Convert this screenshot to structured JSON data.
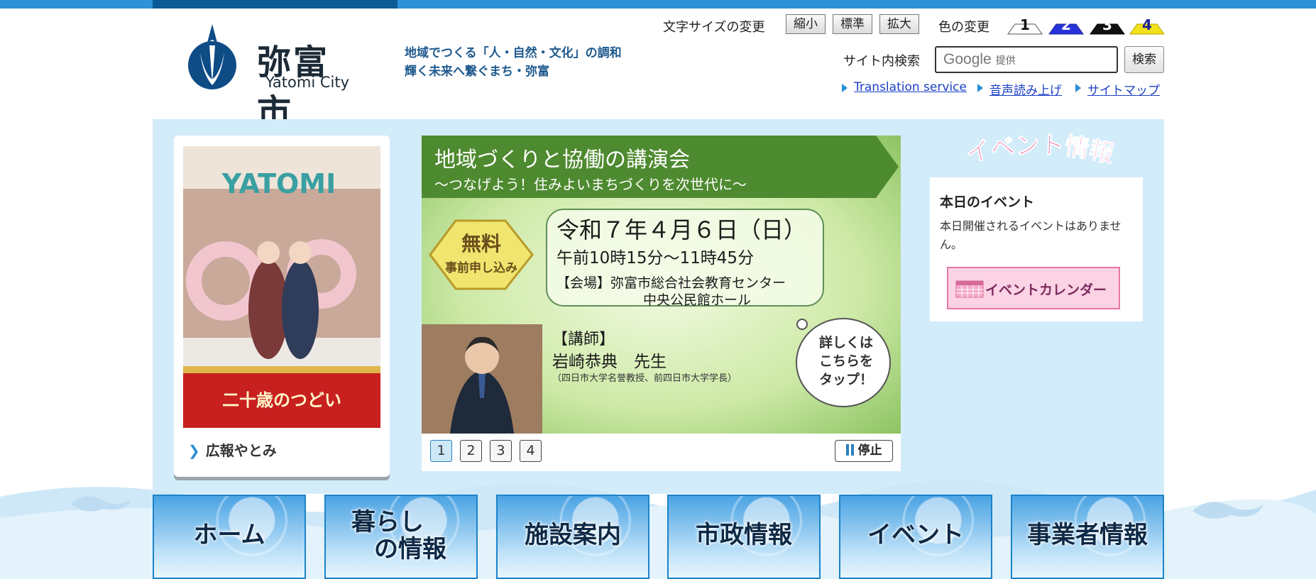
{
  "header": {
    "city_name_ja": "弥富市",
    "city_name_en": "Yatomi City",
    "tagline_line1": "地域でつくる「人・自然・文化」の調和",
    "tagline_line2": "輝く未来へ繋ぐまち・弥富",
    "font_size_label": "文字サイズの変更",
    "font_size_buttons": [
      "縮小",
      "標準",
      "拡大"
    ],
    "color_label": "色の変更",
    "color_buttons": [
      "1",
      "2",
      "3",
      "4"
    ],
    "search_label": "サイト内検索",
    "search_placeholder_brand": "Google",
    "search_placeholder_suffix": "提供",
    "search_button": "検索",
    "links": [
      "Translation service",
      "音声読み上げ",
      "サイトマップ"
    ]
  },
  "colors": {
    "accent_blue": "#2d93d6",
    "dark_blue": "#0d5b95",
    "panel_bg": "#d3ecfa",
    "event_pink": "#e94f8e"
  },
  "kouhou": {
    "cover_title": "YATOMI",
    "cover_caption": "二十歳のつどい",
    "link_label": "広報やとみ"
  },
  "banner": {
    "title": "地域づくりと協働の講演会",
    "subtitle": "～つなげよう！住みよいまちづくりを次世代に～",
    "badge_main": "無料",
    "badge_sub": "事前申し込み",
    "date": "令和７年４月６日（日）",
    "time": "午前10時15分～11時45分",
    "venue_line1": "【会場】弥富市総合社会教育センター",
    "venue_line2": "中央公民館ホール",
    "speaker_heading": "【講師】",
    "speaker_name": "岩崎恭典　先生",
    "speaker_title": "（四日市大学名誉教授、前四日市大学学長）",
    "tap_line1": "詳しくは",
    "tap_line2": "こちらを",
    "tap_line3": "タップ！",
    "slides": [
      "1",
      "2",
      "3",
      "4"
    ],
    "stop_label": "停止"
  },
  "events": {
    "title": "イベント情報",
    "today_heading": "本日のイベント",
    "today_text": "本日開催されるイベントはありません。",
    "calendar_button": "イベントカレンダー"
  },
  "nav": [
    {
      "label": "ホーム"
    },
    {
      "label": "暮らし",
      "label2": "の情報"
    },
    {
      "label": "施設案内"
    },
    {
      "label": "市政情報"
    },
    {
      "label": "イベント"
    },
    {
      "label": "事業者情報"
    }
  ]
}
